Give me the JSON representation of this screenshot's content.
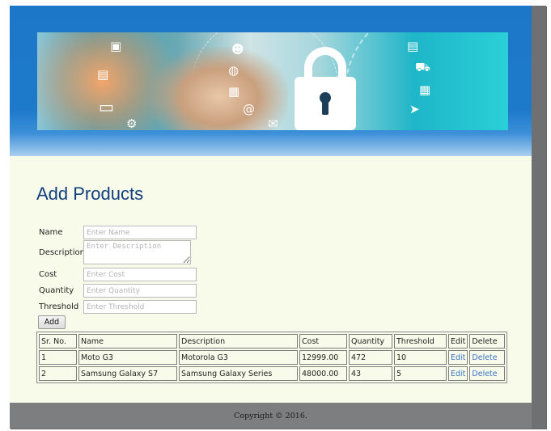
{
  "page": {
    "title": "Add Products"
  },
  "form": {
    "name_label": "Name",
    "name_placeholder": "Enter Name",
    "description_label": "Description",
    "description_placeholder": "Enter Description",
    "cost_label": "Cost",
    "cost_placeholder": "Enter Cost",
    "quantity_label": "Quantity",
    "quantity_placeholder": "Enter Quantity",
    "threshold_label": "Threshold",
    "threshold_placeholder": "Enter Threshold",
    "add_label": "Add"
  },
  "table": {
    "headers": [
      "Sr. No.",
      "Name",
      "Description",
      "Cost",
      "Quantity",
      "Threshold",
      "Edit",
      "Delete"
    ],
    "rows": [
      {
        "sr": "1",
        "name": "Moto G3",
        "description": "Motorola G3",
        "cost": "12999.00",
        "quantity": "472",
        "threshold": "10",
        "edit": "Edit",
        "delete": "Delete"
      },
      {
        "sr": "2",
        "name": "Samsung Galaxy S7",
        "description": "Samsung Galaxy Series",
        "cost": "48000.00",
        "quantity": "43",
        "threshold": "5",
        "edit": "Edit",
        "delete": "Delete"
      }
    ]
  },
  "footer": {
    "copyright": "Copyright © 2016."
  },
  "colors": {
    "header_blue": "#1d77c9",
    "page_background": "#f8fbe9",
    "title_blue": "#0f3f7e",
    "link_blue": "#3974c8",
    "footer_gray": "#7d7e7f"
  },
  "banner": {
    "icons": [
      "lock-icon",
      "shopping-cart-icon",
      "calendar-icon",
      "laptop-icon",
      "mail-icon",
      "gear-icon",
      "globe-icon",
      "at-sign-icon",
      "cursor-icon",
      "people-icon"
    ]
  }
}
